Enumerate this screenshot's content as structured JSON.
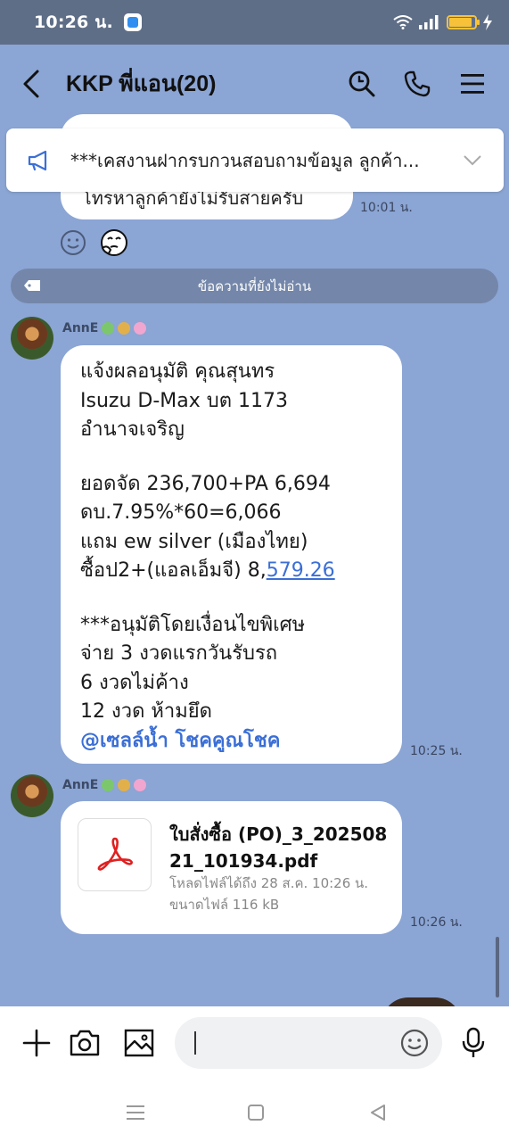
{
  "status_bar": {
    "time": "10:26 น."
  },
  "header": {
    "title": "KKP พี่แอน(20)"
  },
  "previous_message": {
    "text": "โทรหาลูกค้ายังไม่รับสายครับ",
    "time": "10:01 น."
  },
  "announcement": {
    "text": "***เคสงานฝากรบกวนสอบถามข้อมูล ลูกค้า..."
  },
  "unread_divider": {
    "label": "ข้อความที่ยังไม่อ่าน"
  },
  "messages": [
    {
      "sender": "AnnE",
      "lines": [
        "แจ้งผลอนุมัติ คุณสุนทร",
        "Isuzu D-Max บต 1173",
        "อำนาจเจริญ",
        "",
        "ยอดจัด 236,700+PA 6,694",
        "ดบ.7.95%*60=6,066",
        "แถม ew silver (เมืองไทย)",
        "",
        "",
        "***อนุมัติโดยเงื่อนไขพิเศษ",
        "จ่าย 3 งวดแรกวันรับรถ",
        "6 งวดไม่ค้าง",
        "12 งวด ห้ามยึด"
      ],
      "line_with_link_prefix": "ซื้อป2+(แอลเอ็มจี) 8,",
      "line_with_link_link": "579.26",
      "mention": "@เซลล์น้ำ โชคคูณโชค",
      "time": "10:25 น."
    },
    {
      "sender": "AnnE",
      "file_name": "ใบสั่งซื้อ (PO)_3_20250821_101934.pdf",
      "file_expiry": "โหลดไฟล์ได้ถึง 28 ส.ค. 10:26 น.",
      "file_size": "ขนาดไฟล์ 116 kB",
      "time": "10:26 น."
    }
  ],
  "input": {
    "placeholder": ""
  },
  "icons": {
    "back": "back-arrow-icon",
    "search": "search-icon",
    "call": "phone-icon",
    "menu": "menu-icon",
    "announcement": "megaphone-icon",
    "add": "plus-icon",
    "camera": "camera-icon",
    "gallery": "image-icon",
    "emoji": "emoji-icon",
    "mic": "microphone-icon",
    "pdf": "pdf-icon"
  },
  "colors": {
    "chat_background": "#8ba5d4",
    "status_bar": "#5f6e87",
    "link": "#3b6fd6",
    "unread_divider": "#7487aa"
  }
}
